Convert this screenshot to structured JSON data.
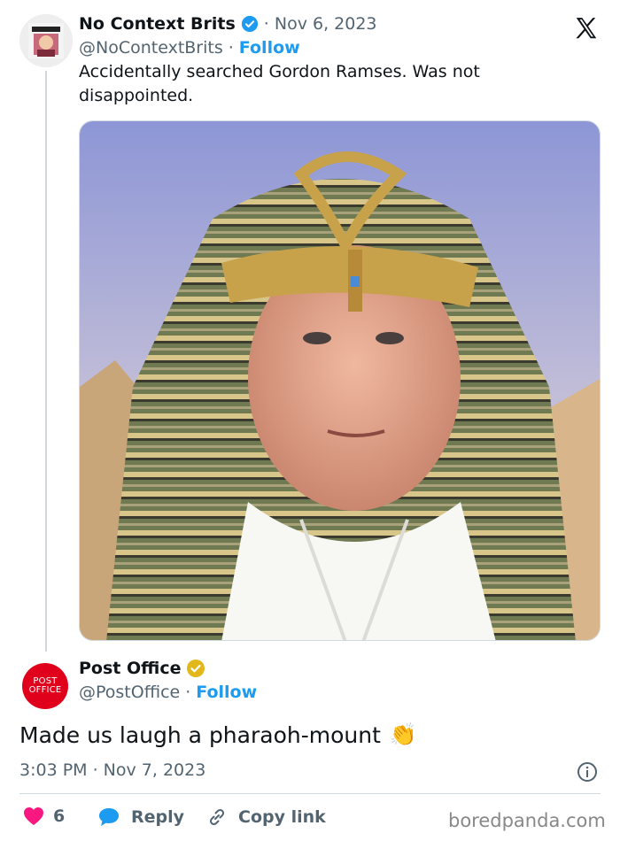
{
  "tweet": {
    "author_name": "No Context Brits",
    "date": "· Nov 6, 2023",
    "handle": "@NoContextBrits",
    "sep": "·",
    "follow": "Follow",
    "text": "Accidentally searched Gordon Ramses. Was not disappointed."
  },
  "reply": {
    "author_name": "Post Office",
    "avatar_text_1": "POST",
    "avatar_text_2": "OFFICE",
    "handle": "@PostOffice",
    "sep": "·",
    "follow": "Follow",
    "text": "Made us laugh a pharaoh-mount",
    "emoji": "👏",
    "timestamp": "3:03 PM · Nov 7, 2023"
  },
  "actions": {
    "like_count": "6",
    "reply_label": "Reply",
    "copy_label": "Copy link"
  },
  "watermark": "boredpanda.com",
  "colors": {
    "accent": "#1d9bf0",
    "like": "#f91880",
    "postoffice_red": "#e0001b",
    "gold_badge": "#e2b719"
  },
  "icons": [
    "x-logo-icon",
    "verified-badge-icon",
    "gold-verified-badge-icon",
    "info-icon",
    "heart-icon",
    "reply-bubble-icon",
    "link-icon",
    "clap-emoji"
  ]
}
